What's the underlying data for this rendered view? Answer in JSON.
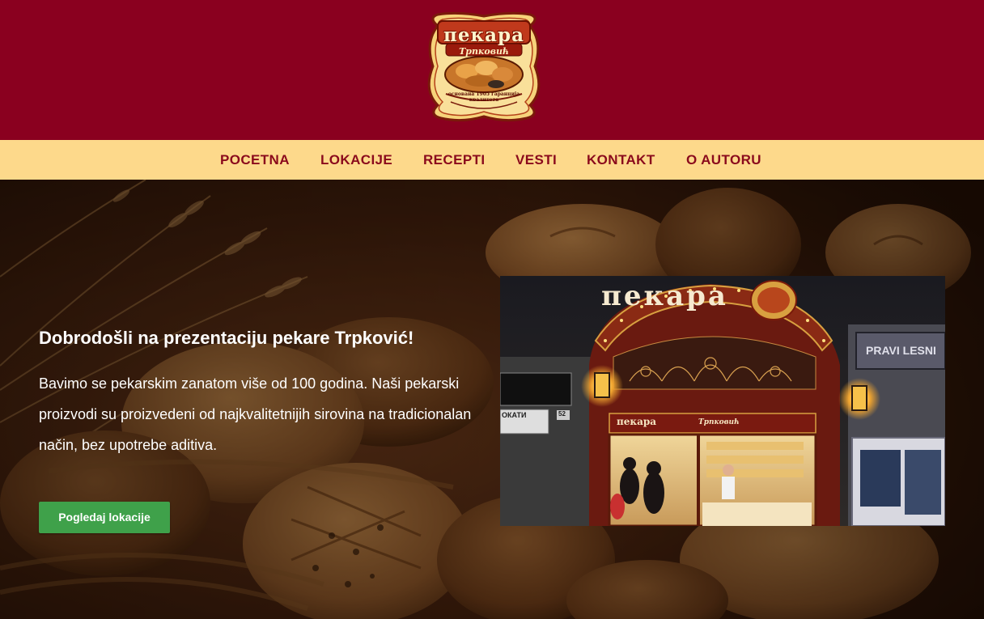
{
  "header": {
    "brand_color": "#8a001f",
    "logo": {
      "name": "bakery-logo",
      "title": "пекара",
      "subtitle": "Трпковић",
      "motto": "основана 1905 гаранција квалитета"
    }
  },
  "nav": {
    "background": "#fdd98b",
    "text_color": "#8a0a1c",
    "items": [
      {
        "label": "POCETNA"
      },
      {
        "label": "LOKACIJE"
      },
      {
        "label": "RECEPTI"
      },
      {
        "label": "VESTI"
      },
      {
        "label": "KONTAKT"
      },
      {
        "label": "O AUTORU"
      }
    ]
  },
  "hero": {
    "title": "Dobrodošli na prezentaciju pekare Trpković!",
    "text": "Bavimo se pekarskim zanatom više od 100 godina. Naši pekarski proizvodi su proizvedeni od najkvalitetnijih sirovina na tradicionalan način, bez upotrebe aditiva.",
    "button_label": "Pogledaj lokacije",
    "button_color": "#3fa14a",
    "photo": {
      "sign_arch": "пекара",
      "sign_lower": "пекара",
      "sign_lower_name": "Трпковић",
      "side_sign": "PRAVI LESNI",
      "street_number": "52",
      "wall_sign": "ОКАТИ"
    }
  }
}
